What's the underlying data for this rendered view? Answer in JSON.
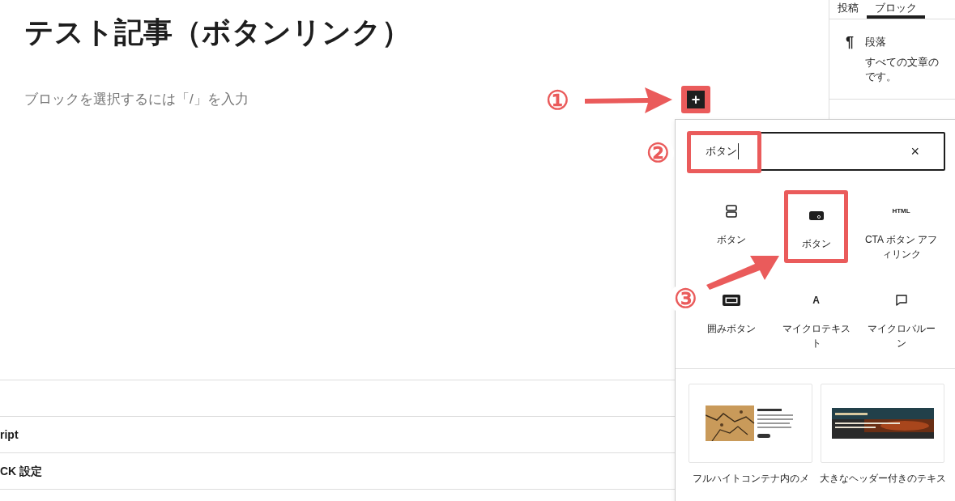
{
  "editor": {
    "title": "テスト記事（ボタンリンク）",
    "placeholder": "ブロックを選択するには「/」を入力",
    "add_block": {
      "symbol": "+",
      "highlighted": true
    }
  },
  "meta_panels": [
    {
      "label": "ript"
    },
    {
      "label": "CK 設定"
    }
  ],
  "sidebar": {
    "tabs": [
      {
        "label": "投稿",
        "selected": false
      },
      {
        "label": "ブロック",
        "selected": true
      }
    ],
    "block_card": {
      "icon": "¶",
      "name": "段落",
      "description": [
        "すべての文章の",
        "です。"
      ]
    }
  },
  "inserter": {
    "search": {
      "value": "ボタン",
      "highlighted": true
    },
    "clear": "×",
    "blocks": [
      {
        "label": "ボタン",
        "kind": "buttons",
        "highlighted": false
      },
      {
        "label": "ボタン",
        "kind": "button",
        "highlighted": true
      },
      {
        "label": "CTA ボタン アフィリンク",
        "kind": "text",
        "icon_text": "HTML",
        "highlighted": false
      },
      {
        "label": "囲みボタン",
        "kind": "boxed",
        "highlighted": false
      },
      {
        "label": "マイクロテキスト",
        "kind": "text",
        "icon_text": "A",
        "highlighted": false
      },
      {
        "label": "マイクロバルーン",
        "kind": "balloon",
        "highlighted": false
      }
    ],
    "patterns": [
      {
        "caption": "フルハイトコンテナ内のメ",
        "kind": "media"
      },
      {
        "caption": "大きなヘッダー付きのテキス",
        "kind": "header"
      }
    ]
  },
  "annotations": [
    {
      "number": "①"
    },
    {
      "number": "②"
    },
    {
      "number": "③"
    }
  ]
}
